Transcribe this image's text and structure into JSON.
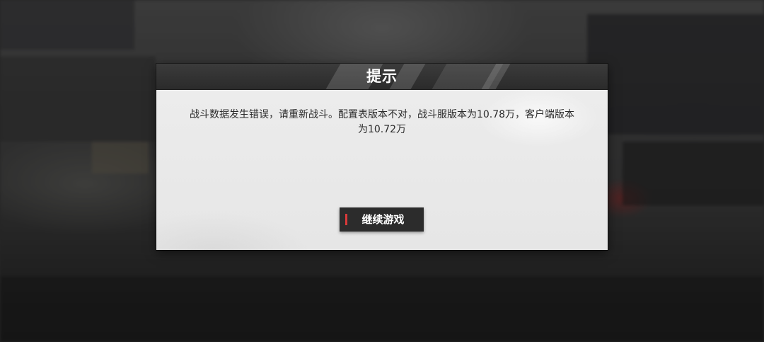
{
  "dialog": {
    "title": "提示",
    "message": "战斗数据发生错误，请重新战斗。配置表版本不对，战斗服版本为10.78万，客户端版本为10.72万",
    "continue_label": "继续游戏"
  },
  "colors": {
    "header_bg": "#2b2b2b",
    "dialog_bg": "#e9e9e9",
    "button_bg": "#2c2c2c",
    "button_accent": "#d93a3a"
  },
  "icons": {
    "button_accent": "accent-bar-icon"
  }
}
